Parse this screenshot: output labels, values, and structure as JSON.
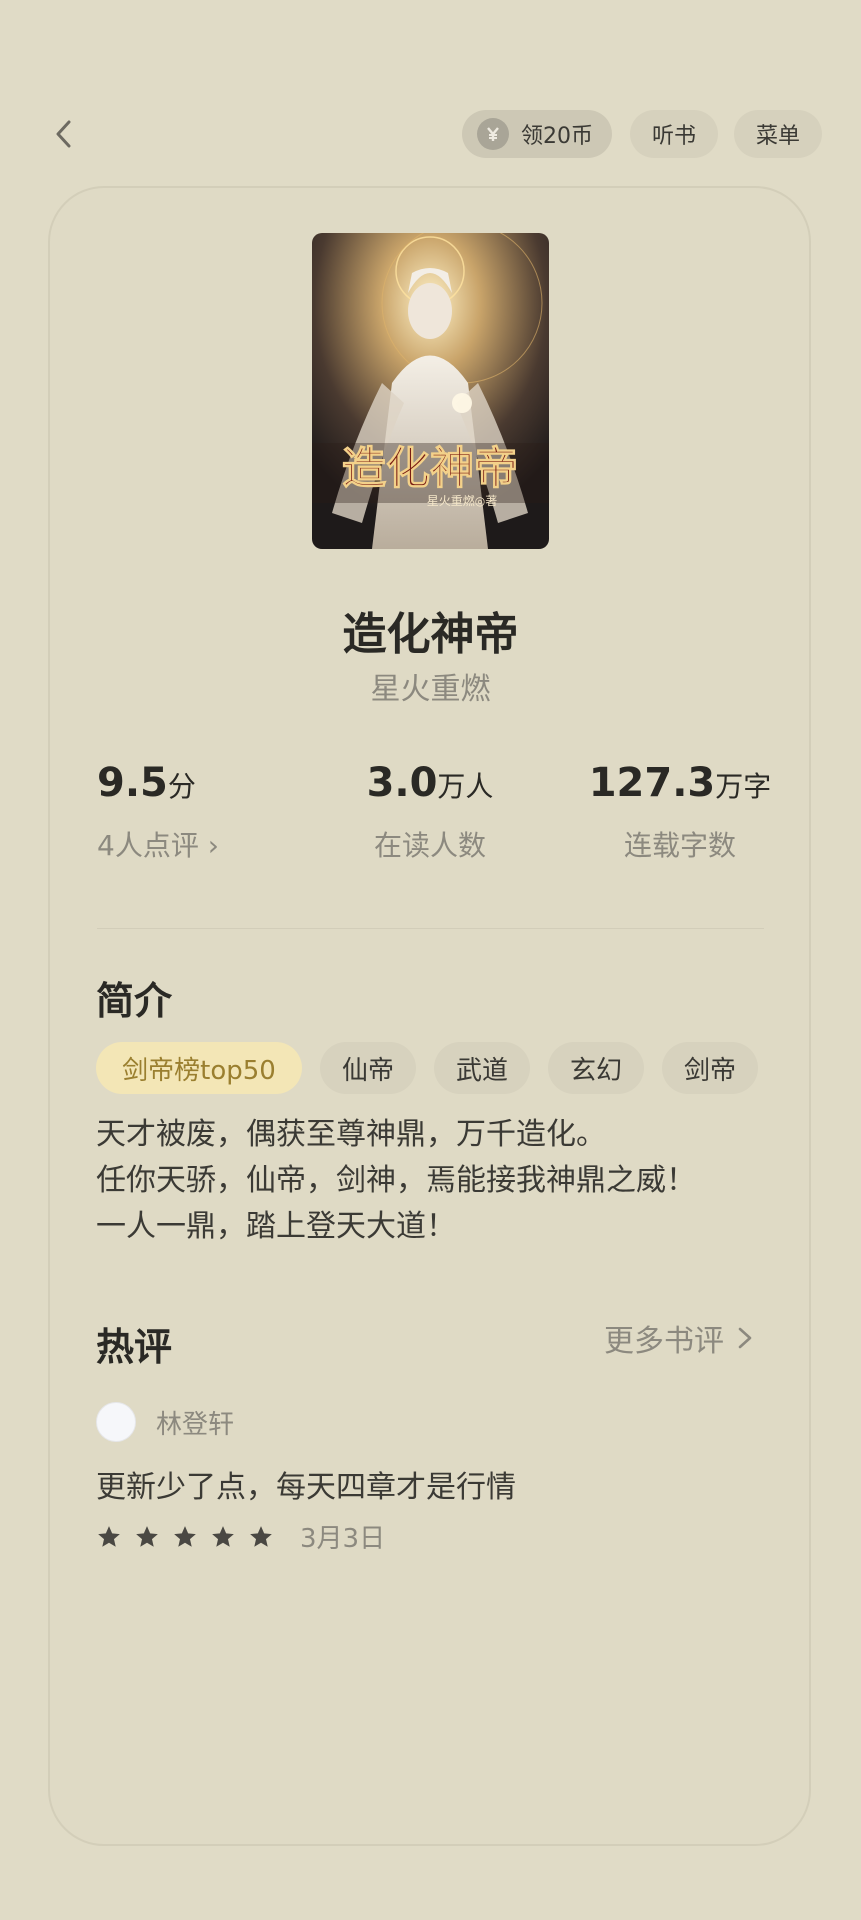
{
  "topbar": {
    "back_icon": "chevron-left-icon",
    "coin_label": "领20币",
    "listen_label": "听书",
    "menu_label": "菜单"
  },
  "book": {
    "title": "造化神帝",
    "author": "星火重燃",
    "cover_title": "造化神帝",
    "cover_author": "星火重燃◎著"
  },
  "stats": [
    {
      "value": "9.5",
      "unit": "分",
      "label": "4人点评 ›"
    },
    {
      "value": "3.0",
      "unit": "万人",
      "label": "在读人数"
    },
    {
      "value": "127.3",
      "unit": "万字",
      "label": "连载字数"
    }
  ],
  "intro": {
    "heading": "简介",
    "tags": [
      "剑帝榜top50",
      "仙帝",
      "武道",
      "玄幻",
      "剑帝"
    ],
    "lines": [
      "天才被废，偶获至尊神鼎，万千造化。",
      "任你天骄，仙帝，剑神，焉能接我神鼎之威！",
      "一人一鼎，踏上登天大道！"
    ]
  },
  "reviews": {
    "heading": "热评",
    "more_label": "更多书评",
    "items": [
      {
        "user": "林登轩",
        "text": "更新少了点，每天四章才是行情",
        "rating": 5,
        "date": "3月3日"
      }
    ]
  },
  "colors": {
    "background": "#e0dbc6",
    "tag_hot_bg": "#f3e6b6",
    "tag_hot_text": "#9a7f2f",
    "muted_text": "#8c897f"
  }
}
